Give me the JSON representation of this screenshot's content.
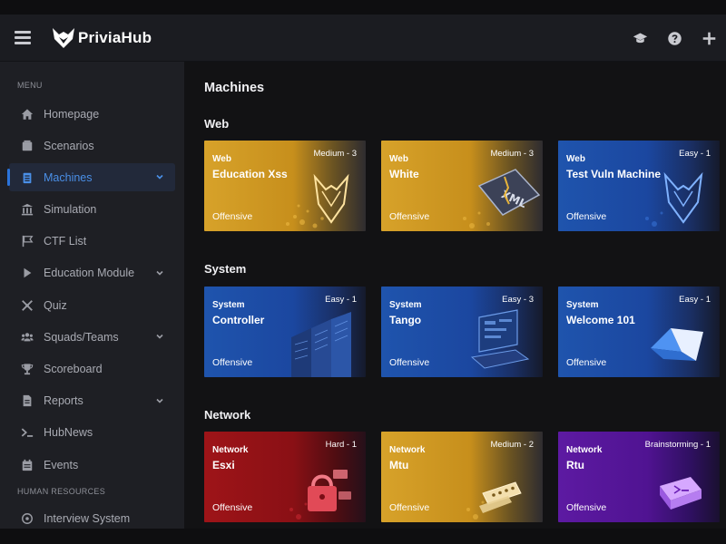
{
  "app": {
    "name": "PriviaHub"
  },
  "header": {
    "icons": [
      "graduation-cap-icon",
      "help-icon",
      "plus-icon"
    ]
  },
  "sidebar": {
    "menu_label": "MENU",
    "items": [
      {
        "label": "Homepage",
        "icon": "home-icon",
        "expandable": false
      },
      {
        "label": "Scenarios",
        "icon": "scenarios-icon",
        "expandable": false
      },
      {
        "label": "Machines",
        "icon": "machines-icon",
        "expandable": true,
        "active": true
      },
      {
        "label": "Simulation",
        "icon": "simulation-icon",
        "expandable": false
      },
      {
        "label": "CTF List",
        "icon": "flag-icon",
        "expandable": false
      },
      {
        "label": "Education Module",
        "icon": "play-icon",
        "expandable": true
      },
      {
        "label": "Quiz",
        "icon": "puzzle-icon",
        "expandable": false
      },
      {
        "label": "Squads/Teams",
        "icon": "users-icon",
        "expandable": true
      },
      {
        "label": "Scoreboard",
        "icon": "trophy-icon",
        "expandable": false
      },
      {
        "label": "Reports",
        "icon": "report-icon",
        "expandable": true
      },
      {
        "label": "HubNews",
        "icon": "terminal-icon",
        "expandable": false
      },
      {
        "label": "Events",
        "icon": "calendar-icon",
        "expandable": false
      }
    ],
    "hr_label": "HUMAN RESOURCES",
    "hr_items": [
      {
        "label": "Interview System",
        "icon": "interview-icon"
      }
    ]
  },
  "main": {
    "title": "Machines",
    "sections": [
      {
        "title": "Web",
        "cards": [
          {
            "category": "Web",
            "name": "Education Xss",
            "difficulty": "Medium - 3",
            "type": "Offensive",
            "theme": "gold",
            "art": "fox-icon"
          },
          {
            "category": "Web",
            "name": "White",
            "difficulty": "Medium - 3",
            "type": "Offensive",
            "theme": "gold",
            "art": "xml-file-icon"
          },
          {
            "category": "Web",
            "name": "Test Vuln Machine",
            "difficulty": "Easy - 1",
            "type": "Offensive",
            "theme": "blue",
            "art": "fox-icon"
          }
        ]
      },
      {
        "title": "System",
        "cards": [
          {
            "category": "System",
            "name": "Controller",
            "difficulty": "Easy - 1",
            "type": "Offensive",
            "theme": "blue",
            "art": "server-rack-icon"
          },
          {
            "category": "System",
            "name": "Tango",
            "difficulty": "Easy - 3",
            "type": "Offensive",
            "theme": "blue",
            "art": "computer-icon"
          },
          {
            "category": "System",
            "name": "Welcome 101",
            "difficulty": "Easy - 1",
            "type": "Offensive",
            "theme": "blue",
            "art": "open-book-icon"
          }
        ]
      },
      {
        "title": "Network",
        "cards": [
          {
            "category": "Network",
            "name": "Esxi",
            "difficulty": "Hard - 1",
            "type": "Offensive",
            "theme": "red",
            "art": "lock-icon"
          },
          {
            "category": "Network",
            "name": "Mtu",
            "difficulty": "Medium - 2",
            "type": "Offensive",
            "theme": "gold",
            "art": "password-icon"
          },
          {
            "category": "Network",
            "name": "Rtu",
            "difficulty": "Brainstorming - 1",
            "type": "Offensive",
            "theme": "purple",
            "art": "terminal-window-icon"
          }
        ]
      }
    ]
  },
  "colors": {
    "accent": "#2b73d9",
    "gold": "#d7a22a",
    "blue": "#1f54ad",
    "red": "#9e1418",
    "purple": "#5d1aa2"
  }
}
